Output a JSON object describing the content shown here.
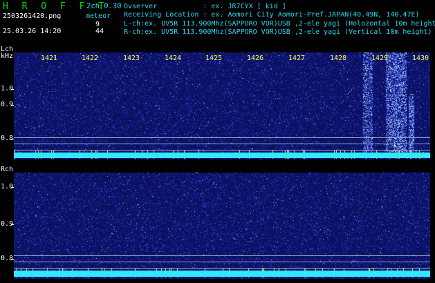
{
  "app": {
    "title": "H R O F F T",
    "version": "2ch 0.30",
    "filename": "2503261420.png",
    "timestamp": "25.03.26 14:20",
    "meteor_label": "meteor",
    "lch_count": "9",
    "rch_count": "44"
  },
  "header": {
    "observer": "Ovserver           : ex. JR7CYX [ kid ]",
    "location": "Receiving Location : ex. Aomori City Aomori-Pref.JAPAN(40.49N, 140.47E)",
    "lch": "L-ch:ex. UV5R 113.900Mhz(SAPPORO VOR)USB ,2-ele yagi (Holozontal 10m height)",
    "rch": "R-ch:ex. UV5R 113.900Mhz(SAPPORO VOR)USB ,2-ele yagi (Vertical 10m height)"
  },
  "lch_panel": {
    "channel_label": "Lch",
    "unit_label": "kHz",
    "y_ticks": [
      "1.0",
      "0.9",
      "0.8"
    ]
  },
  "rch_panel": {
    "channel_label": "Rch",
    "y_ticks": [
      "1.0",
      "0.9",
      "0.8"
    ]
  },
  "time_axis": [
    "1421",
    "1422",
    "1423",
    "1424",
    "1425",
    "1426",
    "1427",
    "1428",
    "1429",
    "1430"
  ],
  "colors": {
    "background": "#000000",
    "panel": "#0b1060",
    "title": "#00e000",
    "header_text": "#28d8f0",
    "axis_text": "#ffff40",
    "baseline": "#30e8ff"
  }
}
